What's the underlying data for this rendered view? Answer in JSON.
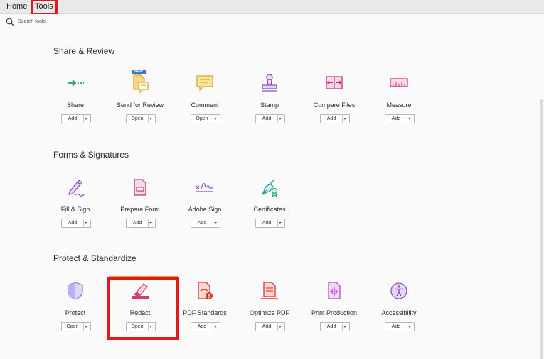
{
  "nav": {
    "home_label": "Home",
    "tools_label": "Tools"
  },
  "search": {
    "placeholder": "Search tools"
  },
  "accent_highlight": "#e0191c",
  "sections": [
    {
      "title": "Share & Review",
      "tools": [
        {
          "name": "Share",
          "button": "Add",
          "icon": "share-arrow-icon",
          "color": "#2aa06a"
        },
        {
          "name": "Send for Review",
          "button": "Open",
          "icon": "send-for-review-icon",
          "color": "#d9a91f",
          "badge": "NEW"
        },
        {
          "name": "Comment",
          "button": "Open",
          "icon": "comment-icon",
          "color": "#d9a91f"
        },
        {
          "name": "Stamp",
          "button": "Add",
          "icon": "stamp-icon",
          "color": "#8a4fc6"
        },
        {
          "name": "Compare Files",
          "button": "Add",
          "icon": "compare-files-icon",
          "color": "#c2387f"
        },
        {
          "name": "Measure",
          "button": "Add",
          "icon": "ruler-icon",
          "color": "#c2387f"
        }
      ]
    },
    {
      "title": "Forms & Signatures",
      "tools": [
        {
          "name": "Fill & Sign",
          "button": "Add",
          "icon": "fill-sign-icon",
          "color": "#8a4fc6"
        },
        {
          "name": "Prepare Form",
          "button": "Add",
          "icon": "prepare-form-icon",
          "color": "#c2387f"
        },
        {
          "name": "Adobe Sign",
          "button": "Add",
          "icon": "signature-icon",
          "color": "#8a4fc6"
        },
        {
          "name": "Certificates",
          "button": "Add",
          "icon": "certificate-pen-icon",
          "color": "#2a9c8c"
        }
      ]
    },
    {
      "title": "Protect & Standardize",
      "tools": [
        {
          "name": "Protect",
          "button": "Open",
          "icon": "shield-icon",
          "color": "#8a7fd6"
        },
        {
          "name": "Redact",
          "button": "Open",
          "icon": "redact-marker-icon",
          "color": "#d23b6a"
        },
        {
          "name": "PDF Standards",
          "button": "Add",
          "icon": "pdf-standards-icon",
          "color": "#d8362e"
        },
        {
          "name": "Optimize PDF",
          "button": "Add",
          "icon": "optimize-pdf-icon",
          "color": "#d8362e"
        },
        {
          "name": "Print Production",
          "button": "Add",
          "icon": "print-production-icon",
          "color": "#b54fc6"
        },
        {
          "name": "Accessibility",
          "button": "Add",
          "icon": "accessibility-icon",
          "color": "#8a4fc6"
        }
      ]
    }
  ]
}
